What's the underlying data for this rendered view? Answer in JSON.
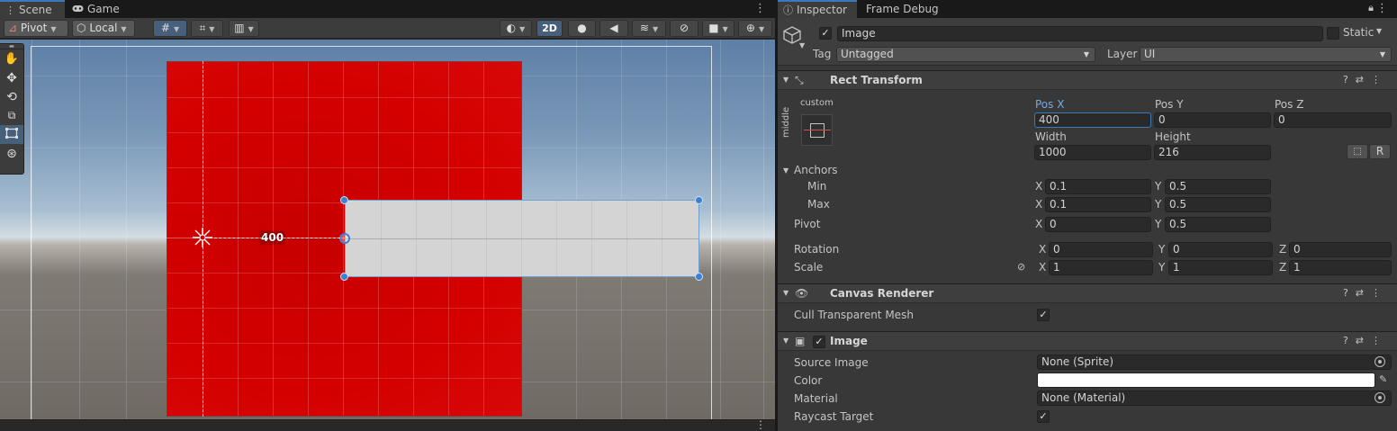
{
  "scene_tabs": [
    {
      "label": "Scene",
      "icon": "grid-icon"
    },
    {
      "label": "Game",
      "icon": "gamepad-icon"
    }
  ],
  "scene_toolbar": {
    "pivot": "Pivot",
    "local": "Local",
    "mode_2d": "2D"
  },
  "scene_view": {
    "distance_label": "400",
    "colors": {
      "red_panel": "#d40000",
      "white_rect": "#d4d4d4",
      "handle": "#3b82d6"
    }
  },
  "inspector_tabs": [
    {
      "label": "Inspector",
      "icon": "info-icon"
    },
    {
      "label": "Frame Debug"
    }
  ],
  "header": {
    "name": "Image",
    "static_label": "Static",
    "tag_label": "Tag",
    "tag_value": "Untagged",
    "layer_label": "Layer",
    "layer_value": "UI"
  },
  "rect_transform": {
    "title": "Rect Transform",
    "anchor_preset_top": "custom",
    "anchor_preset_side": "middle",
    "pos_x_label": "Pos X",
    "pos_y_label": "Pos Y",
    "pos_z_label": "Pos Z",
    "pos_x": "400",
    "pos_y": "0",
    "pos_z": "0",
    "width_label": "Width",
    "height_label": "Height",
    "width": "1000",
    "height": "216",
    "raw_button": "R",
    "anchors_label": "Anchors",
    "min_label": "Min",
    "max_label": "Max",
    "min_x": "0.1",
    "min_y": "0.5",
    "max_x": "0.1",
    "max_y": "0.5",
    "pivot_label": "Pivot",
    "pivot_x": "0",
    "pivot_y": "0.5",
    "rotation_label": "Rotation",
    "rot_x": "0",
    "rot_y": "0",
    "rot_z": "0",
    "scale_label": "Scale",
    "scale_x": "1",
    "scale_y": "1",
    "scale_z": "1",
    "axis_x": "X",
    "axis_y": "Y",
    "axis_z": "Z"
  },
  "canvas_renderer": {
    "title": "Canvas Renderer",
    "cull_label": "Cull Transparent Mesh"
  },
  "image_component": {
    "title": "Image",
    "source_label": "Source Image",
    "source_value": "None (Sprite)",
    "color_label": "Color",
    "color_value": "#ffffff",
    "material_label": "Material",
    "material_value": "None (Material)",
    "raycast_label": "Raycast Target"
  }
}
